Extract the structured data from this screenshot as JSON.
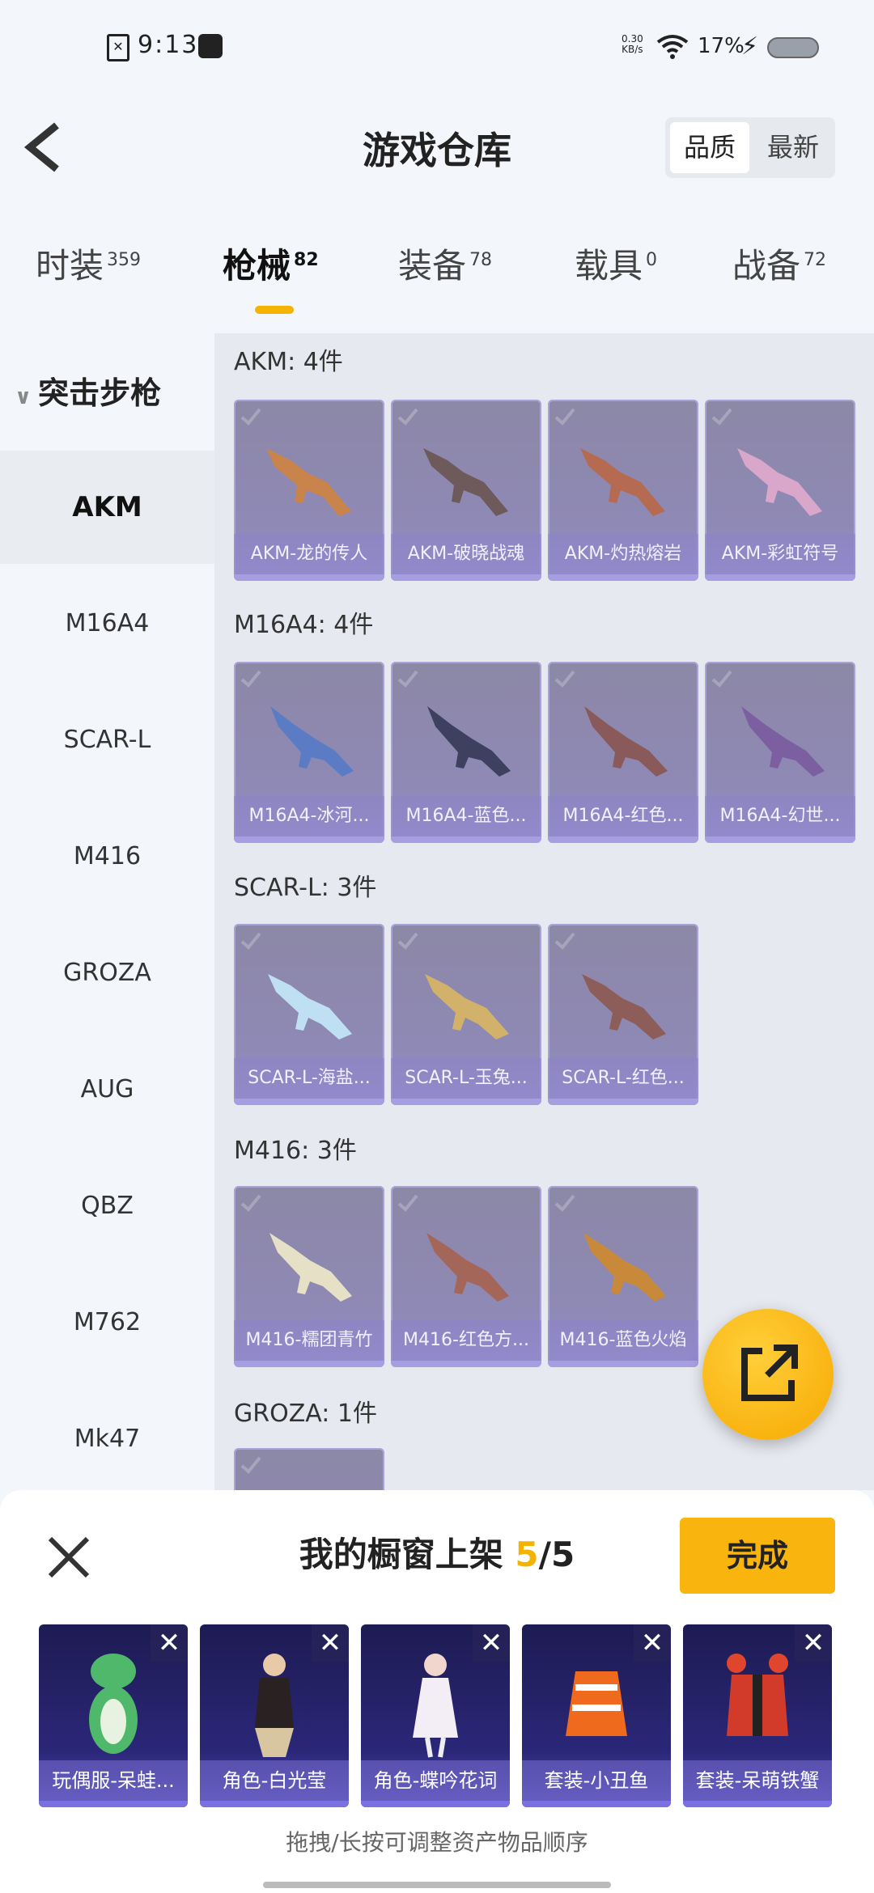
{
  "status_bar": {
    "time": "9:13",
    "net_speed": "0.30\nKB/s",
    "battery": "17%"
  },
  "header": {
    "title": "游戏仓库",
    "sort_options": [
      "品质",
      "最新"
    ]
  },
  "tabs": [
    {
      "label": "时装",
      "count": "359"
    },
    {
      "label": "枪械",
      "count": "82"
    },
    {
      "label": "装备",
      "count": "78"
    },
    {
      "label": "载具",
      "count": "0"
    },
    {
      "label": "战备",
      "count": "72"
    }
  ],
  "sidebar": {
    "category": "突击步枪",
    "items": [
      "AKM",
      "M16A4",
      "SCAR-L",
      "M416",
      "GROZA",
      "AUG",
      "QBZ",
      "M762",
      "Mk47"
    ]
  },
  "groups": [
    {
      "title": "AKM: 4件",
      "items": [
        "AKM-龙的传人",
        "AKM-破晓战魂",
        "AKM-灼热熔岩",
        "AKM-彩虹符号"
      ]
    },
    {
      "title": "M16A4: 4件",
      "items": [
        "M16A4-冰河...",
        "M16A4-蓝色...",
        "M16A4-红色...",
        "M16A4-幻世..."
      ]
    },
    {
      "title": "SCAR-L: 3件",
      "items": [
        "SCAR-L-海盐...",
        "SCAR-L-玉兔...",
        "SCAR-L-红色..."
      ]
    },
    {
      "title": "M416: 3件",
      "items": [
        "M416-糯团青竹",
        "M416-红色方...",
        "M416-蓝色火焰"
      ]
    },
    {
      "title": "GROZA: 1件",
      "items": [
        ""
      ]
    }
  ],
  "shelf": {
    "title": "我的橱窗上架",
    "count": "5",
    "total": "/5",
    "done_label": "完成",
    "items": [
      "玩偶服-呆蛙...",
      "角色-白光莹",
      "角色-蝶吟花词",
      "套装-小丑鱼",
      "套装-呆萌铁蟹"
    ],
    "hint": "拖拽/长按可调整资产物品顺序"
  },
  "colors": {
    "accent": "#f9b40d",
    "card": "#8f89b6",
    "shelf_card": "#2b2779"
  }
}
